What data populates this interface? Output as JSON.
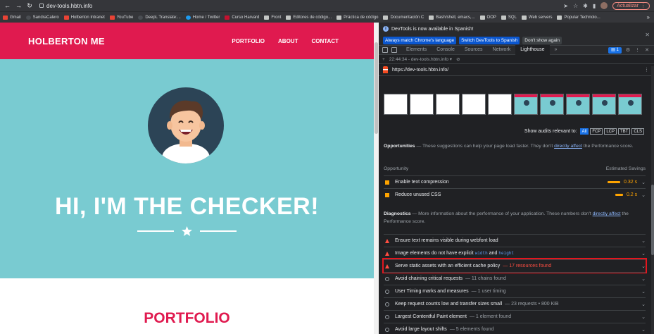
{
  "browser": {
    "url": "dev-tools.hbtn.info",
    "update_label": "Actualizar",
    "bookmarks": [
      {
        "label": "Gmail",
        "icon": "red"
      },
      {
        "label": "SandraCalero",
        "icon": "dark"
      },
      {
        "label": "Holberton Intranet",
        "icon": "red"
      },
      {
        "label": "YouTube",
        "icon": "red"
      },
      {
        "label": "DeepL Translate:...",
        "icon": "dark"
      },
      {
        "label": "Home / Twitter",
        "icon": "blue"
      },
      {
        "label": "Curso Harvard",
        "icon": "crimson"
      },
      {
        "label": "Front",
        "icon": "folder"
      },
      {
        "label": "Editores de código...",
        "icon": "folder"
      },
      {
        "label": "Práctica de código",
        "icon": "folder"
      },
      {
        "label": "Documentación C",
        "icon": "folder"
      },
      {
        "label": "Bash/shell, emacs,...",
        "icon": "folder"
      },
      {
        "label": "OOP",
        "icon": "folder"
      },
      {
        "label": "SQL",
        "icon": "folder"
      },
      {
        "label": "Web servers",
        "icon": "folder"
      },
      {
        "label": "Popular Technolo...",
        "icon": "folder"
      }
    ],
    "more_bookmarks": "»"
  },
  "site": {
    "brand": "HOLBERTON ME",
    "nav": [
      "PORTFOLIO",
      "ABOUT",
      "CONTACT"
    ],
    "hero_title": "HI, I'M THE CHECKER!",
    "portfolio_title": "PORTFOLIO",
    "colors": {
      "primary": "#e01a4f",
      "hero_bg": "#79cbd1"
    }
  },
  "devtools": {
    "notice": "DevTools is now available in Spanish!",
    "notice_buttons": [
      "Always match Chrome's language",
      "Switch DevTools to Spanish",
      "Don't show again"
    ],
    "tabs": [
      "Elements",
      "Console",
      "Sources",
      "Network",
      "Lighthouse"
    ],
    "active_tab": "Lighthouse",
    "issues_count": "1",
    "report_time": "22:44:34 - dev-tools.hbtn.info",
    "report_url": "https://dev-tools.hbtn.info/",
    "filter_label": "Show audits relevant to:",
    "filters": [
      "All",
      "FCP",
      "LCP",
      "TBT",
      "CLS"
    ],
    "opportunities": {
      "title": "Opportunities",
      "desc": " — These suggestions can help your page load faster. They don't ",
      "link": "directly affect",
      "desc2": " the Performance score.",
      "col_left": "Opportunity",
      "col_right": "Estimated Savings",
      "items": [
        {
          "label": "Enable text compression",
          "saving": "0.32 s",
          "fill": 0.32
        },
        {
          "label": "Reduce unused CSS",
          "saving": "0.2 s",
          "fill": 0.2
        }
      ]
    },
    "diagnostics": {
      "title": "Diagnostics",
      "desc": " — More information about the performance of your application. These numbers don't ",
      "link": "directly affect",
      "desc2": " the Performance score.",
      "items": [
        {
          "label": "Ensure text remains visible during webfont load",
          "sub": "",
          "type": "fail"
        },
        {
          "label": "Image elements do not have explicit ",
          "code1": "width",
          "mid": " and ",
          "code2": "height",
          "type": "fail"
        },
        {
          "label": "Serve static assets with an efficient cache policy",
          "sub": "— 17 resources found",
          "type": "fail",
          "highlighted": true
        },
        {
          "label": "Avoid chaining critical requests",
          "sub": "— 11 chains found",
          "type": "info"
        },
        {
          "label": "User Timing marks and measures",
          "sub": "— 1 user timing",
          "type": "info"
        },
        {
          "label": "Keep request counts low and transfer sizes small",
          "sub": "— 23 requests • 800 KiB",
          "type": "info"
        },
        {
          "label": "Largest Contentful Paint element",
          "sub": "— 1 element found",
          "type": "info"
        },
        {
          "label": "Avoid large layout shifts",
          "sub": "— 5 elements found",
          "type": "info"
        }
      ]
    }
  }
}
